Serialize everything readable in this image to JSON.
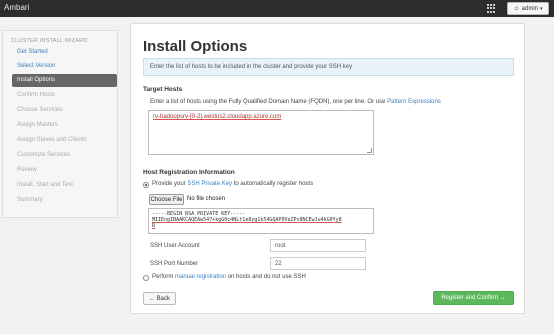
{
  "app": {
    "brand": "Ambari"
  },
  "topbar": {
    "admin_label": "admin",
    "caret": "▾"
  },
  "sidebar": {
    "title": "CLUSTER INSTALL WIZARD",
    "items": [
      {
        "label": "Get Started",
        "state": "done"
      },
      {
        "label": "Select Version",
        "state": "done"
      },
      {
        "label": "Install Options",
        "state": "active"
      },
      {
        "label": "Confirm Hosts",
        "state": "disabled"
      },
      {
        "label": "Choose Services",
        "state": "disabled"
      },
      {
        "label": "Assign Masters",
        "state": "disabled"
      },
      {
        "label": "Assign Slaves and Clients",
        "state": "disabled"
      },
      {
        "label": "Customize Services",
        "state": "disabled"
      },
      {
        "label": "Review",
        "state": "disabled"
      },
      {
        "label": "Install, Start and Test",
        "state": "disabled"
      },
      {
        "label": "Summary",
        "state": "disabled"
      }
    ]
  },
  "main": {
    "title": "Install Options",
    "hint": "Enter the list of hosts to be included in the cluster and provide your SSH key",
    "target_hosts": {
      "heading": "Target Hosts",
      "desc": "Enter a list of hosts using the Fully Qualified Domain Name (FQDN), one per line. Or use",
      "desc_link": "Pattern Expressions",
      "value": "rv-hadoopsrv-[0-2].westus2.cloudapp.azure.com"
    },
    "registration": {
      "heading": "Host Registration Information",
      "option1_prefix": "Provide your",
      "option1_link": "SSH Private Key",
      "option1_suffix": "to automatically register hosts",
      "choose_file": "Choose File",
      "no_file": "No file chosen",
      "key_lines": [
        "-----BEGIN RSA PRIVATE KEY-----",
        "MIIEogIBAAKCAQEAw547+kgG0c4NLt1e8yg1k54GQAP0VeZPx8NCEwJu4kG0Yy8",
        "R"
      ],
      "ssh_user_label": "SSH User Account",
      "ssh_user_value": "root",
      "ssh_port_label": "SSH Port Number",
      "ssh_port_value": "22",
      "option2_prefix": "Perform",
      "option2_link": "manual registration",
      "option2_suffix": "on hosts and do not use SSH"
    },
    "buttons": {
      "back": "← Back",
      "next": "Register and Confirm →"
    }
  },
  "colors": {
    "topbar": "#2d2d2d",
    "accent": "#3a7fc1",
    "active_item": "#666666",
    "primary": "#5cb85c"
  }
}
